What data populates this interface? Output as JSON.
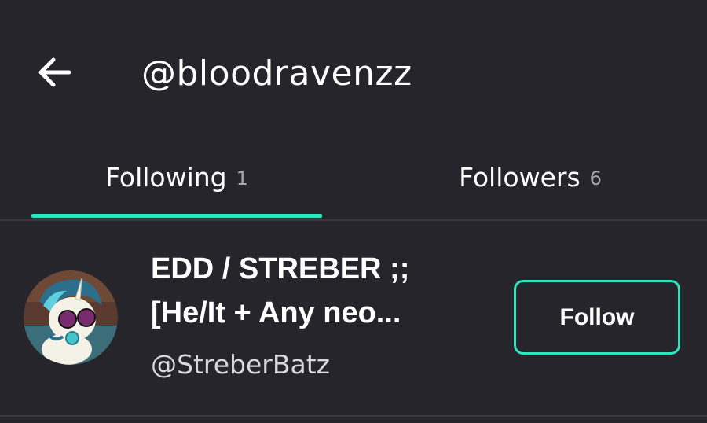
{
  "header": {
    "back_icon": "arrow-left-icon",
    "title": "@bloodravenzz"
  },
  "tabs": [
    {
      "label": "Following",
      "count": "1",
      "active": true
    },
    {
      "label": "Followers",
      "count": "6",
      "active": false
    }
  ],
  "list": {
    "items": [
      {
        "display_name_line1": "EDD / STREBER ;;",
        "display_name_line2": "[He/It + Any neo...",
        "handle": "@StreberBatz",
        "avatar_icon": "unicorn-pony-avatar",
        "action_label": "Follow"
      }
    ]
  },
  "colors": {
    "background": "#26252c",
    "accent": "#2ee6bd",
    "text": "#ffffff",
    "muted": "#a9a8b0",
    "divider": "#3a3940"
  }
}
